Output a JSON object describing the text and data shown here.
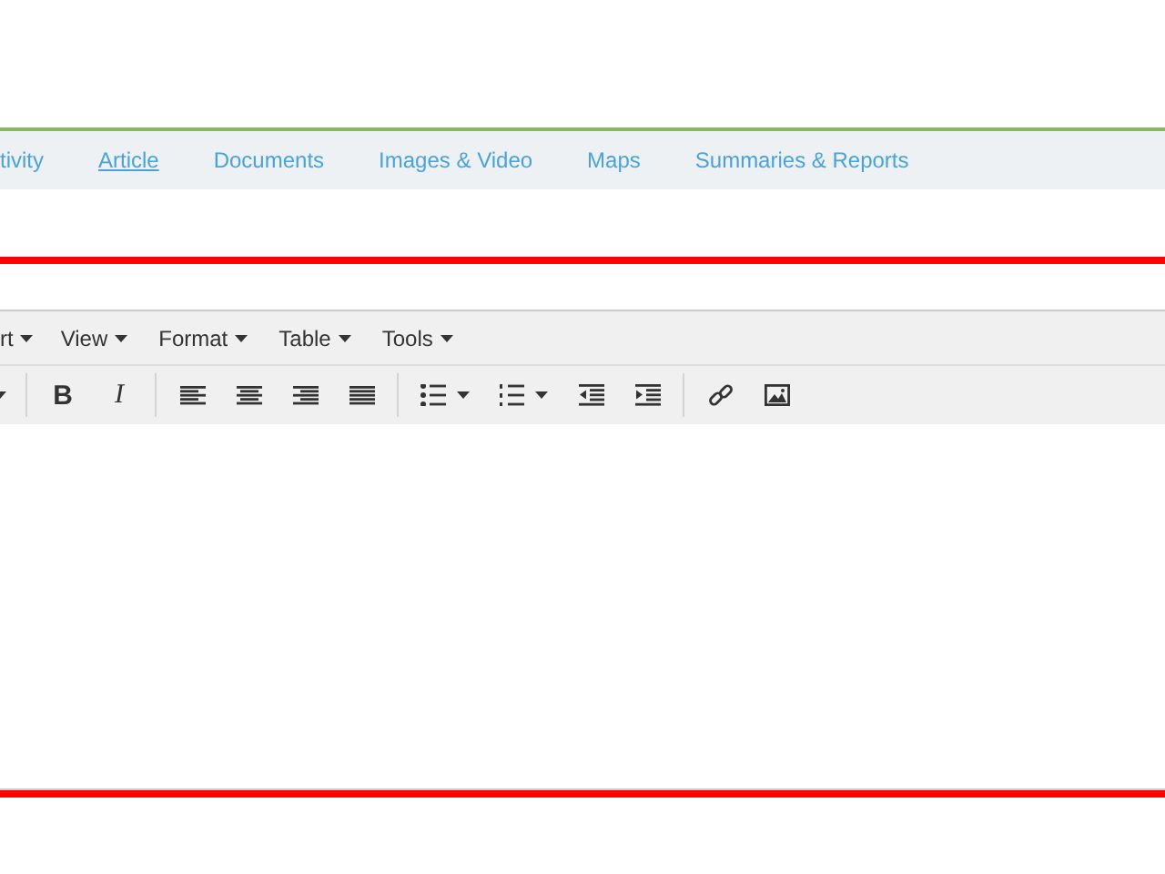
{
  "tabs": [
    {
      "label": "tivity",
      "selected": false
    },
    {
      "label": "Article",
      "selected": true
    },
    {
      "label": "Documents",
      "selected": false
    },
    {
      "label": "Images & Video",
      "selected": false
    },
    {
      "label": "Maps",
      "selected": false
    },
    {
      "label": "Summaries & Reports",
      "selected": false
    }
  ],
  "editor": {
    "menus": [
      "rt",
      "View",
      "Format",
      "Table",
      "Tools"
    ],
    "toolbar": [
      [
        {
          "kind": "caret"
        }
      ],
      [
        {
          "kind": "bold",
          "text": "B"
        },
        {
          "kind": "italic",
          "text": "I"
        }
      ],
      [
        {
          "kind": "align-left"
        },
        {
          "kind": "align-center"
        },
        {
          "kind": "align-right"
        },
        {
          "kind": "justify"
        }
      ],
      [
        {
          "kind": "bullet-list",
          "dropdown": true
        },
        {
          "kind": "numbered-list",
          "dropdown": true
        },
        {
          "kind": "outdent"
        },
        {
          "kind": "indent"
        }
      ],
      [
        {
          "kind": "link"
        },
        {
          "kind": "image"
        }
      ]
    ]
  }
}
